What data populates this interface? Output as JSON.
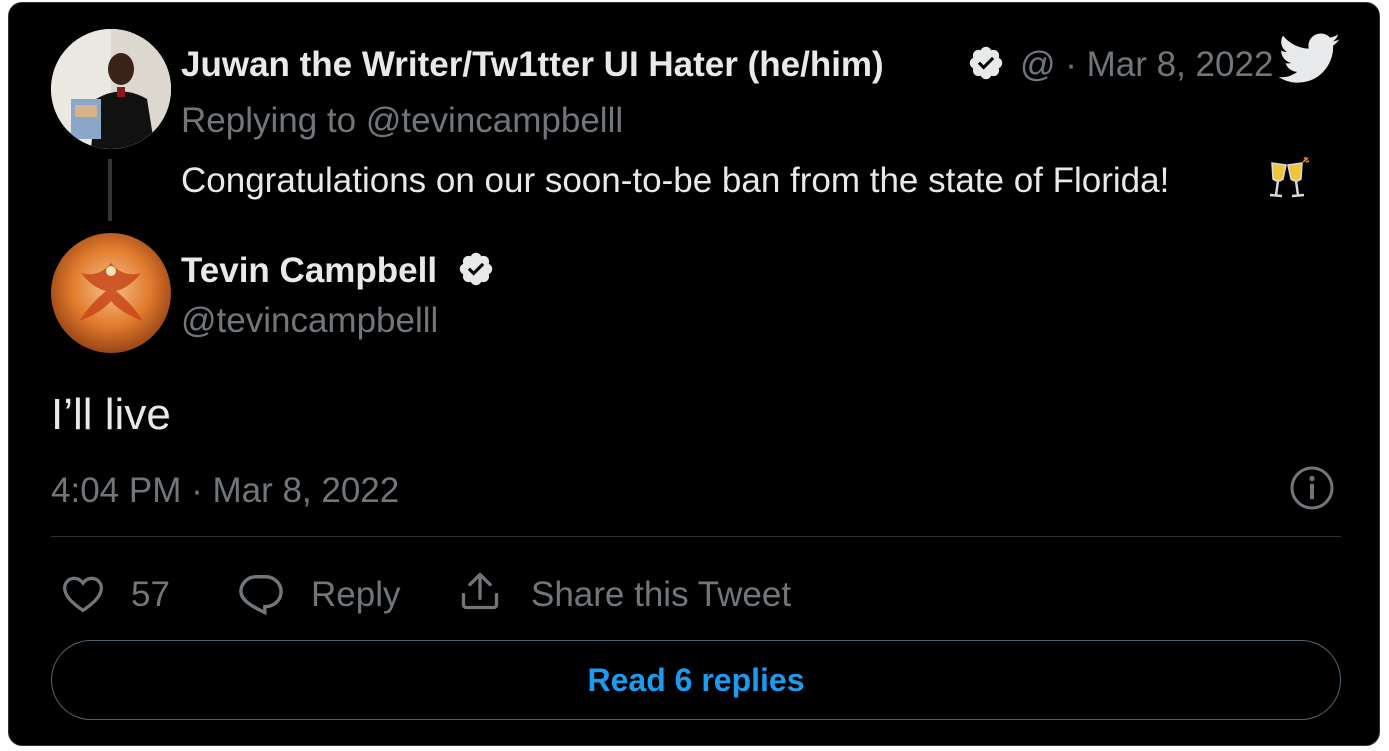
{
  "parent_tweet": {
    "author_name": "Juwan the Writer/Tw1tter UI Hater (he/him)",
    "handle_dot_date": "@ · Mar 8, 2022",
    "replying_to": "Replying to @tevincampbelll",
    "text": "Congratulations on our soon-to-be ban from the state of Florida!",
    "emoji": "🥂"
  },
  "main_tweet": {
    "author_name": "Tevin Campbell",
    "handle": "@tevincampbelll",
    "text": "I’ll live",
    "timestamp": "4:04 PM · Mar 8, 2022"
  },
  "actions": {
    "like_count": "57",
    "reply_label": "Reply",
    "share_label": "Share this Tweet"
  },
  "read_replies_label": "Read 6 replies",
  "colors": {
    "background": "#000000",
    "text_primary": "#e7e9ea",
    "text_muted": "#71767b",
    "accent": "#1d9bf0",
    "verified_badge": "#e7e9ea"
  },
  "icons": [
    "verified-badge-icon",
    "twitter-bird-icon",
    "info-icon",
    "heart-icon",
    "reply-icon",
    "share-icon"
  ]
}
